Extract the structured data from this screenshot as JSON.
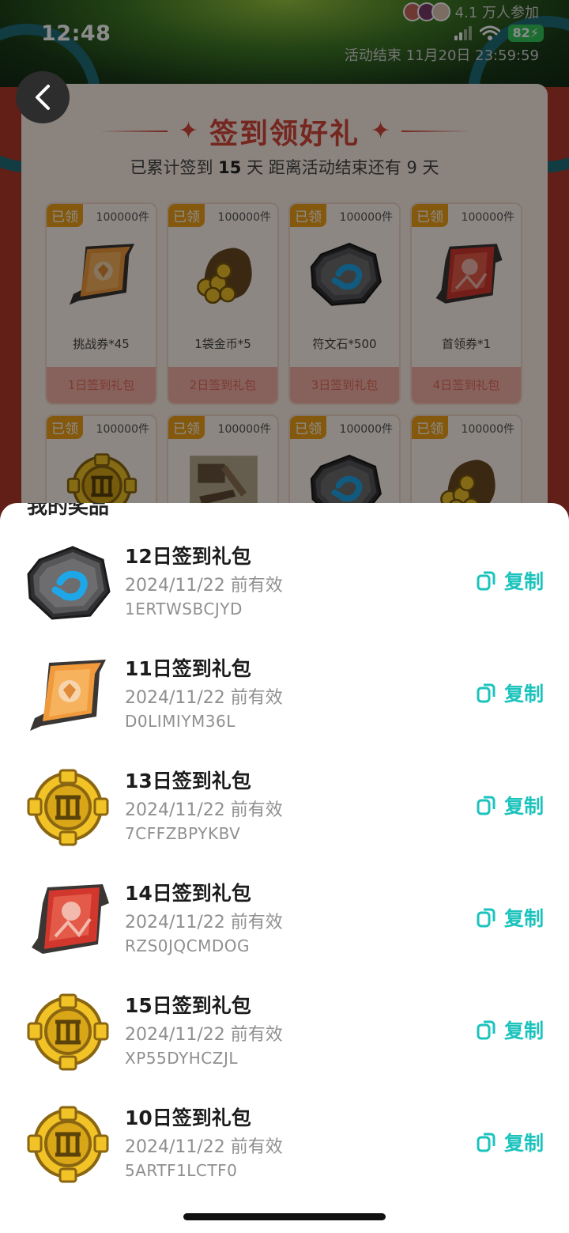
{
  "status_bar": {
    "time": "12:48",
    "battery": "82"
  },
  "header": {
    "participants": "4.1 万人参加",
    "activity_end": "活动结束 11月20日 23:59:59"
  },
  "signin": {
    "title": "签到领好礼",
    "sub_prefix": "已累计签到",
    "days": "15",
    "sub_mid": "天  距离活动结束还有",
    "remain": "9",
    "sub_suffix": "天",
    "rewards": [
      {
        "badge": "已领",
        "qty": "100000件",
        "name": "挑战券*45",
        "foot": "1日签到礼包",
        "art": "ticket-orange"
      },
      {
        "badge": "已领",
        "qty": "100000件",
        "name": "1袋金币*5",
        "foot": "2日签到礼包",
        "art": "coin-bag"
      },
      {
        "badge": "已领",
        "qty": "100000件",
        "name": "符文石*500",
        "foot": "3日签到礼包",
        "art": "rune-stone"
      },
      {
        "badge": "已领",
        "qty": "100000件",
        "name": "首领券*1",
        "foot": "4日签到礼包",
        "art": "ticket-red"
      },
      {
        "badge": "已领",
        "qty": "100000件",
        "name": "",
        "foot": "",
        "art": "gold-medal"
      },
      {
        "badge": "已领",
        "qty": "100000件",
        "name": "",
        "foot": "",
        "art": "tools"
      },
      {
        "badge": "已领",
        "qty": "100000件",
        "name": "",
        "foot": "",
        "art": "rune-stone"
      },
      {
        "badge": "已领",
        "qty": "100000件",
        "name": "",
        "foot": "",
        "art": "coin-bag"
      }
    ]
  },
  "sheet": {
    "title": "我的奖品",
    "items": [
      {
        "title": "12日签到礼包",
        "expiry": "2024/11/22 前有效",
        "code": "1ERTWSBCJYD",
        "copy": "复制",
        "icon": "rune-stone"
      },
      {
        "title": "11日签到礼包",
        "expiry": "2024/11/22 前有效",
        "code": "D0LIMIYM36L",
        "copy": "复制",
        "icon": "ticket-orange"
      },
      {
        "title": "13日签到礼包",
        "expiry": "2024/11/22 前有效",
        "code": "7CFFZBPYKBV",
        "copy": "复制",
        "icon": "gold-medal"
      },
      {
        "title": "14日签到礼包",
        "expiry": "2024/11/22 前有效",
        "code": "RZS0JQCMDOG",
        "copy": "复制",
        "icon": "ticket-red"
      },
      {
        "title": "15日签到礼包",
        "expiry": "2024/11/22 前有效",
        "code": "XP55DYHCZJL",
        "copy": "复制",
        "icon": "gold-medal"
      },
      {
        "title": "10日签到礼包",
        "expiry": "2024/11/22 前有效",
        "code": "5ARTF1LCTF0",
        "copy": "复制",
        "icon": "gold-medal"
      }
    ]
  }
}
